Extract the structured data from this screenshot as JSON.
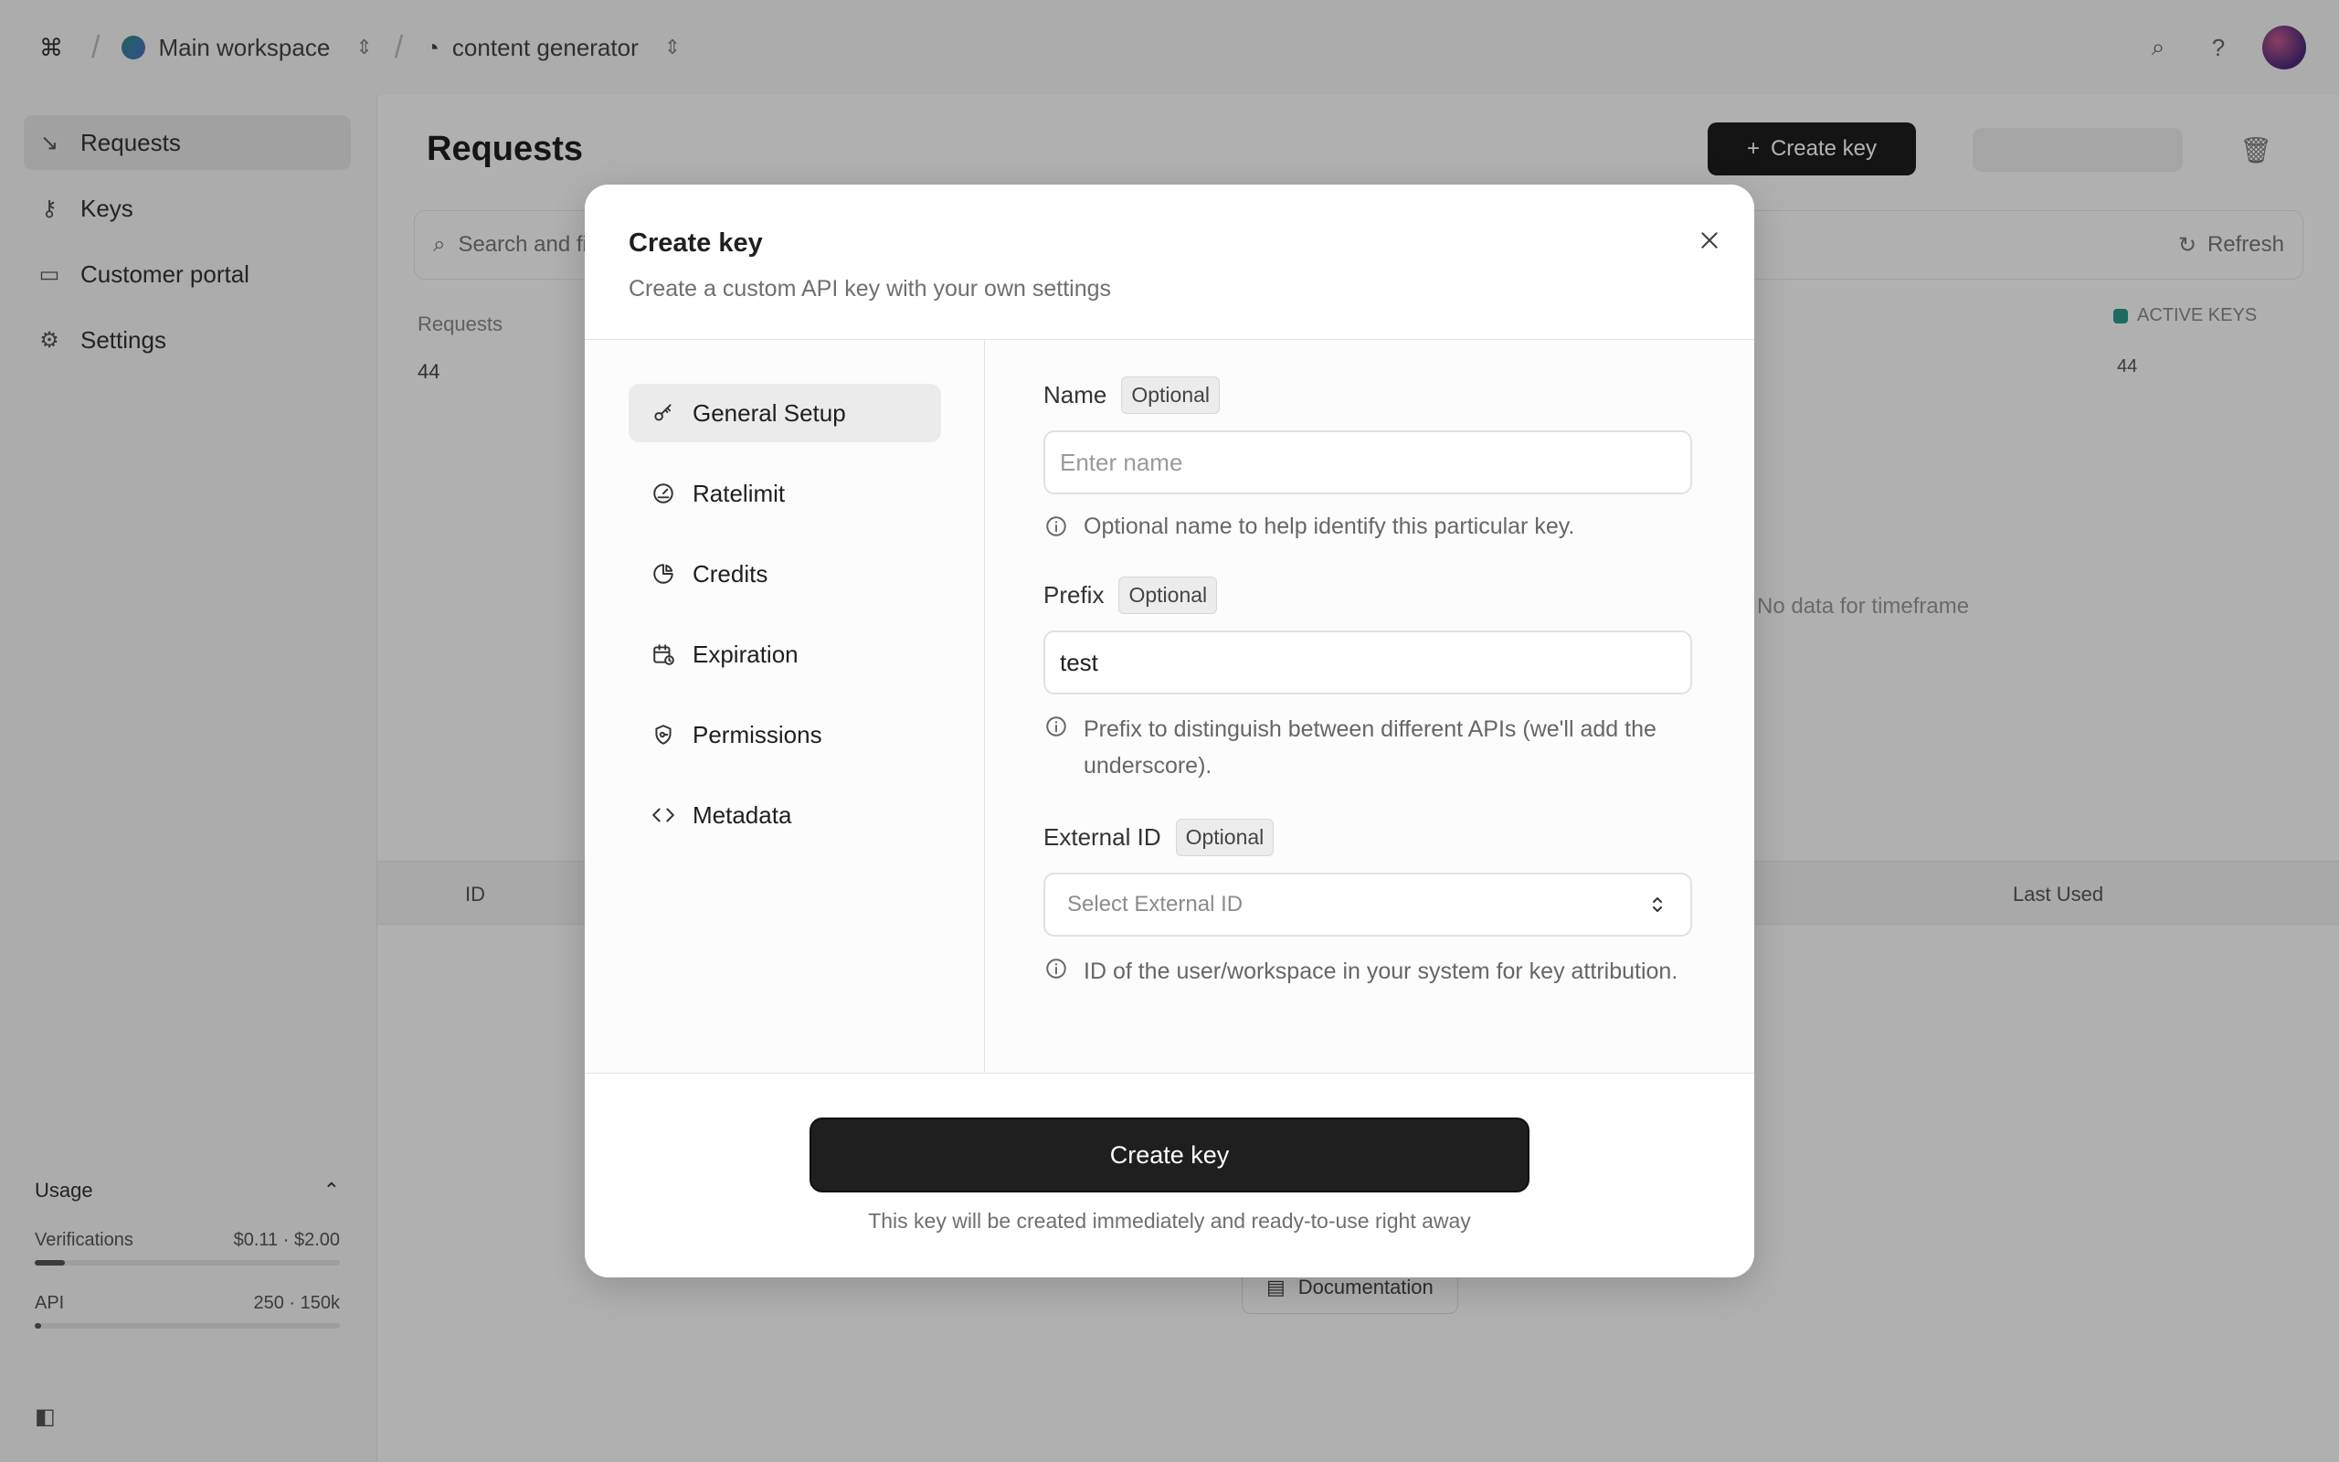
{
  "background": {
    "topbar": {
      "workspace": "Main workspace",
      "api_name": "content generator"
    },
    "sidebar": {
      "items": [
        {
          "label": "Requests",
          "icon": "requests-icon"
        },
        {
          "label": "Keys",
          "icon": "key-icon"
        },
        {
          "label": "Customer portal",
          "icon": "portal-icon"
        },
        {
          "label": "Settings",
          "icon": "settings-icon"
        }
      ],
      "usage": {
        "title": "Usage",
        "row1_label": "Verifications",
        "row1_value": "$0.11 · $2.00",
        "row1_fraction": 0.1,
        "row2_label": "API",
        "row2_value": "250 · 150k",
        "row2_fraction": 0.02
      }
    },
    "main": {
      "title": "Requests",
      "create_button": "Create key",
      "search_placeholder": "Search and filter...",
      "refresh": "Refresh",
      "requests_label": "Requests",
      "requests_count": "44",
      "legend": "ACTIVE KEYS",
      "legend_value": "44",
      "chart_hint": "No data for timeframe",
      "col_id": "ID",
      "col_last_used": "Last Used",
      "docs": "Documentation"
    }
  },
  "modal": {
    "title": "Create key",
    "subtitle": "Create a custom API key with your own settings",
    "nav": [
      {
        "label": "General Setup",
        "icon": "key-icon",
        "active": true
      },
      {
        "label": "Ratelimit",
        "icon": "gauge-icon",
        "active": false
      },
      {
        "label": "Credits",
        "icon": "pie-chart-icon",
        "active": false
      },
      {
        "label": "Expiration",
        "icon": "calendar-clock-icon",
        "active": false
      },
      {
        "label": "Permissions",
        "icon": "shield-key-icon",
        "active": false
      },
      {
        "label": "Metadata",
        "icon": "code-icon",
        "active": false
      }
    ],
    "fields": {
      "name": {
        "label": "Name",
        "badge": "Optional",
        "placeholder": "Enter name",
        "value": "",
        "hint": "Optional name to help identify this particular key."
      },
      "prefix": {
        "label": "Prefix",
        "badge": "Optional",
        "placeholder": "",
        "value": "test",
        "hint": "Prefix to distinguish between different APIs (we'll add the underscore)."
      },
      "external_id": {
        "label": "External ID",
        "badge": "Optional",
        "placeholder": "Select External ID",
        "hint": "ID of the user/workspace in your system for key attribution."
      }
    },
    "submit_label": "Create key",
    "footer_note": "This key will be created immediately and ready-to-use right away"
  },
  "colors": {
    "primary_button": "#1f1f1f",
    "overlay": "rgba(0,0,0,0.30)",
    "accent_legend": "#2e9a88"
  }
}
